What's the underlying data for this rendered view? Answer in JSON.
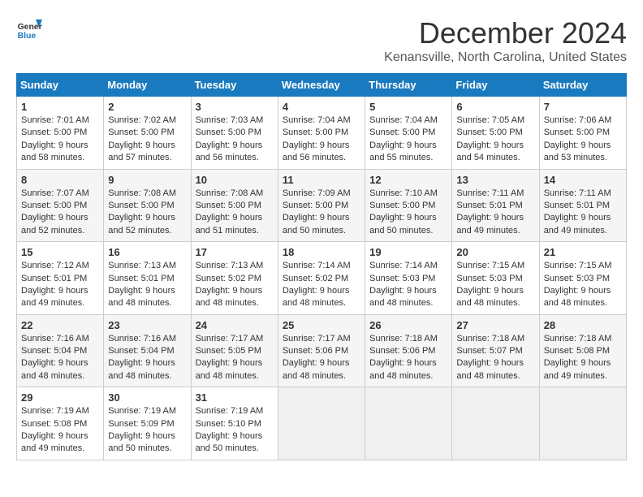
{
  "logo": {
    "line1": "General",
    "line2": "Blue"
  },
  "title": "December 2024",
  "subtitle": "Kenansville, North Carolina, United States",
  "days_of_week": [
    "Sunday",
    "Monday",
    "Tuesday",
    "Wednesday",
    "Thursday",
    "Friday",
    "Saturday"
  ],
  "weeks": [
    [
      {
        "day": "1",
        "sunrise": "7:01 AM",
        "sunset": "5:00 PM",
        "daylight": "9 hours and 58 minutes."
      },
      {
        "day": "2",
        "sunrise": "7:02 AM",
        "sunset": "5:00 PM",
        "daylight": "9 hours and 57 minutes."
      },
      {
        "day": "3",
        "sunrise": "7:03 AM",
        "sunset": "5:00 PM",
        "daylight": "9 hours and 56 minutes."
      },
      {
        "day": "4",
        "sunrise": "7:04 AM",
        "sunset": "5:00 PM",
        "daylight": "9 hours and 56 minutes."
      },
      {
        "day": "5",
        "sunrise": "7:04 AM",
        "sunset": "5:00 PM",
        "daylight": "9 hours and 55 minutes."
      },
      {
        "day": "6",
        "sunrise": "7:05 AM",
        "sunset": "5:00 PM",
        "daylight": "9 hours and 54 minutes."
      },
      {
        "day": "7",
        "sunrise": "7:06 AM",
        "sunset": "5:00 PM",
        "daylight": "9 hours and 53 minutes."
      }
    ],
    [
      {
        "day": "8",
        "sunrise": "7:07 AM",
        "sunset": "5:00 PM",
        "daylight": "9 hours and 52 minutes."
      },
      {
        "day": "9",
        "sunrise": "7:08 AM",
        "sunset": "5:00 PM",
        "daylight": "9 hours and 52 minutes."
      },
      {
        "day": "10",
        "sunrise": "7:08 AM",
        "sunset": "5:00 PM",
        "daylight": "9 hours and 51 minutes."
      },
      {
        "day": "11",
        "sunrise": "7:09 AM",
        "sunset": "5:00 PM",
        "daylight": "9 hours and 50 minutes."
      },
      {
        "day": "12",
        "sunrise": "7:10 AM",
        "sunset": "5:00 PM",
        "daylight": "9 hours and 50 minutes."
      },
      {
        "day": "13",
        "sunrise": "7:11 AM",
        "sunset": "5:01 PM",
        "daylight": "9 hours and 49 minutes."
      },
      {
        "day": "14",
        "sunrise": "7:11 AM",
        "sunset": "5:01 PM",
        "daylight": "9 hours and 49 minutes."
      }
    ],
    [
      {
        "day": "15",
        "sunrise": "7:12 AM",
        "sunset": "5:01 PM",
        "daylight": "9 hours and 49 minutes."
      },
      {
        "day": "16",
        "sunrise": "7:13 AM",
        "sunset": "5:01 PM",
        "daylight": "9 hours and 48 minutes."
      },
      {
        "day": "17",
        "sunrise": "7:13 AM",
        "sunset": "5:02 PM",
        "daylight": "9 hours and 48 minutes."
      },
      {
        "day": "18",
        "sunrise": "7:14 AM",
        "sunset": "5:02 PM",
        "daylight": "9 hours and 48 minutes."
      },
      {
        "day": "19",
        "sunrise": "7:14 AM",
        "sunset": "5:03 PM",
        "daylight": "9 hours and 48 minutes."
      },
      {
        "day": "20",
        "sunrise": "7:15 AM",
        "sunset": "5:03 PM",
        "daylight": "9 hours and 48 minutes."
      },
      {
        "day": "21",
        "sunrise": "7:15 AM",
        "sunset": "5:03 PM",
        "daylight": "9 hours and 48 minutes."
      }
    ],
    [
      {
        "day": "22",
        "sunrise": "7:16 AM",
        "sunset": "5:04 PM",
        "daylight": "9 hours and 48 minutes."
      },
      {
        "day": "23",
        "sunrise": "7:16 AM",
        "sunset": "5:04 PM",
        "daylight": "9 hours and 48 minutes."
      },
      {
        "day": "24",
        "sunrise": "7:17 AM",
        "sunset": "5:05 PM",
        "daylight": "9 hours and 48 minutes."
      },
      {
        "day": "25",
        "sunrise": "7:17 AM",
        "sunset": "5:06 PM",
        "daylight": "9 hours and 48 minutes."
      },
      {
        "day": "26",
        "sunrise": "7:18 AM",
        "sunset": "5:06 PM",
        "daylight": "9 hours and 48 minutes."
      },
      {
        "day": "27",
        "sunrise": "7:18 AM",
        "sunset": "5:07 PM",
        "daylight": "9 hours and 48 minutes."
      },
      {
        "day": "28",
        "sunrise": "7:18 AM",
        "sunset": "5:08 PM",
        "daylight": "9 hours and 49 minutes."
      }
    ],
    [
      {
        "day": "29",
        "sunrise": "7:19 AM",
        "sunset": "5:08 PM",
        "daylight": "9 hours and 49 minutes."
      },
      {
        "day": "30",
        "sunrise": "7:19 AM",
        "sunset": "5:09 PM",
        "daylight": "9 hours and 50 minutes."
      },
      {
        "day": "31",
        "sunrise": "7:19 AM",
        "sunset": "5:10 PM",
        "daylight": "9 hours and 50 minutes."
      },
      null,
      null,
      null,
      null
    ]
  ]
}
